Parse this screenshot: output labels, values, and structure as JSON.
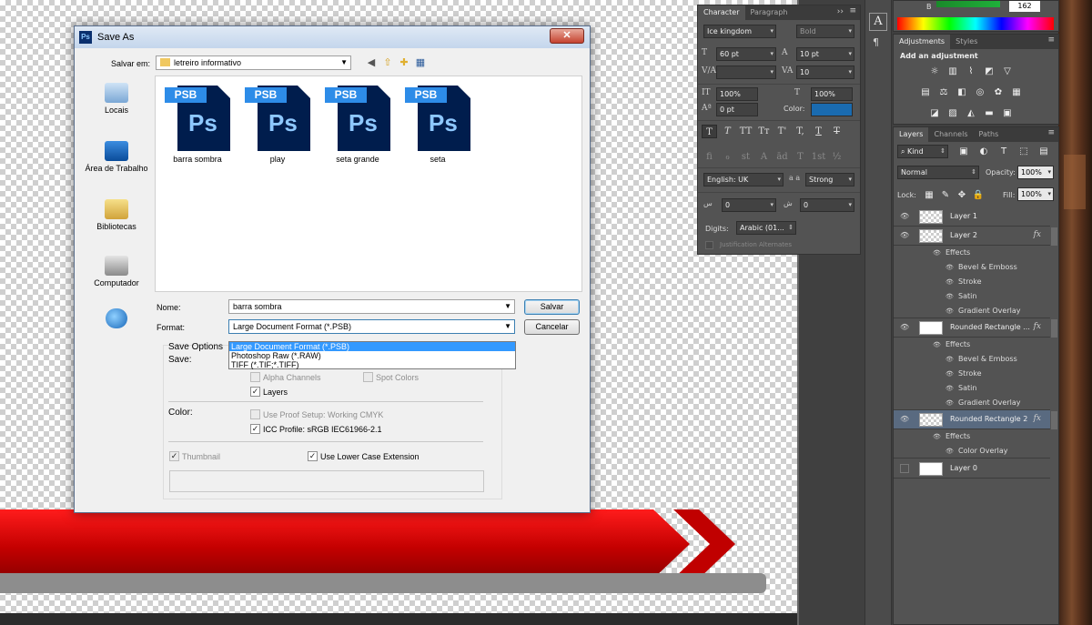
{
  "dialog": {
    "title": "Save As",
    "save_in_label": "Salvar em:",
    "save_in_value": "letreiro informativo",
    "places": [
      {
        "label": "Locais",
        "icon": "recent-places-icon"
      },
      {
        "label": "Área de Trabalho",
        "icon": "desktop-icon"
      },
      {
        "label": "Bibliotecas",
        "icon": "libraries-icon"
      },
      {
        "label": "Computador",
        "icon": "computer-icon"
      },
      {
        "label": "",
        "icon": "network-icon"
      }
    ],
    "files": [
      {
        "tag": "PSB",
        "ps": "Ps",
        "name": "barra sombra"
      },
      {
        "tag": "PSB",
        "ps": "Ps",
        "name": "play"
      },
      {
        "tag": "PSB",
        "ps": "Ps",
        "name": "seta grande"
      },
      {
        "tag": "PSB",
        "ps": "Ps",
        "name": "seta"
      }
    ],
    "name_label": "Nome:",
    "name_value": "barra sombra",
    "format_label": "Format:",
    "format_value": "Large Document Format (*.PSB)",
    "format_options": [
      "Large Document Format (*.PSB)",
      "Photoshop Raw (*.RAW)",
      "TIFF (*.TIF;*.TIFF)"
    ],
    "save_button": "Salvar",
    "cancel_button": "Cancelar",
    "save_options_label": "Save Options",
    "save_label": "Save:",
    "alpha_channels": "Alpha Channels",
    "spot_colors": "Spot Colors",
    "layers": "Layers",
    "color_label": "Color:",
    "use_proof_setup": "Use Proof Setup:  Working CMYK",
    "icc_profile": "ICC Profile:  sRGB IEC61966-2.1",
    "thumbnail": "Thumbnail",
    "lower_case_ext": "Use Lower Case Extension"
  },
  "character_panel": {
    "tabs": [
      "Character",
      "Paragraph"
    ],
    "font_family": "Ice kingdom",
    "font_style": "Bold",
    "font_size": "60 pt",
    "leading": "10 pt",
    "kerning": "",
    "tracking": "10",
    "vertical_scale": "100%",
    "horizontal_scale": "100%",
    "baseline_shift": "0 pt",
    "color_label": "Color:",
    "color_value": "#1a6bb0",
    "style_buttons": [
      "T",
      "T",
      "TT",
      "Tт",
      "T'",
      "T,",
      "T",
      "T"
    ],
    "opentype_buttons": [
      "fi",
      "ℴ",
      "st",
      "A",
      "ād",
      "T",
      "1st",
      "½"
    ],
    "language": "English: UK",
    "aa_label": "a a",
    "anti_alias": "Strong",
    "digits_label": "Digits:",
    "digits_value": "Arabic (01...",
    "justification": "Justification Alternates",
    "arabic_field1": "0",
    "arabic_field2": "0"
  },
  "color_panel": {
    "b_label": "B",
    "b_value": "162"
  },
  "adjustments_panel": {
    "tabs": [
      "Adjustments",
      "Styles"
    ],
    "heading": "Add an adjustment"
  },
  "layers_panel": {
    "tabs": [
      "Layers",
      "Channels",
      "Paths"
    ],
    "kind": "Kind",
    "blend_mode": "Normal",
    "opacity_label": "Opacity:",
    "opacity_value": "100%",
    "lock_label": "Lock:",
    "fill_label": "Fill:",
    "fill_value": "100%",
    "layers": [
      {
        "name": "Layer 1",
        "fx": "",
        "effects": []
      },
      {
        "name": "Layer 2",
        "fx": "fx",
        "effects_label": "Effects",
        "effects": [
          "Bevel & Emboss",
          "Stroke",
          "Satin",
          "Gradient Overlay"
        ]
      },
      {
        "name": "Rounded Rectangle ...",
        "fx": "fx",
        "effects_label": "Effects",
        "effects": [
          "Bevel & Emboss",
          "Stroke",
          "Satin",
          "Gradient Overlay"
        ]
      },
      {
        "name": "Rounded Rectangle 2",
        "fx": "fx",
        "effects_label": "Effects",
        "effects": [
          "Color Overlay"
        ]
      },
      {
        "name": "Layer 0",
        "fx": "",
        "effects": []
      }
    ]
  },
  "toolbar": {
    "character_tool": "A",
    "paragraph_tool": "¶"
  }
}
